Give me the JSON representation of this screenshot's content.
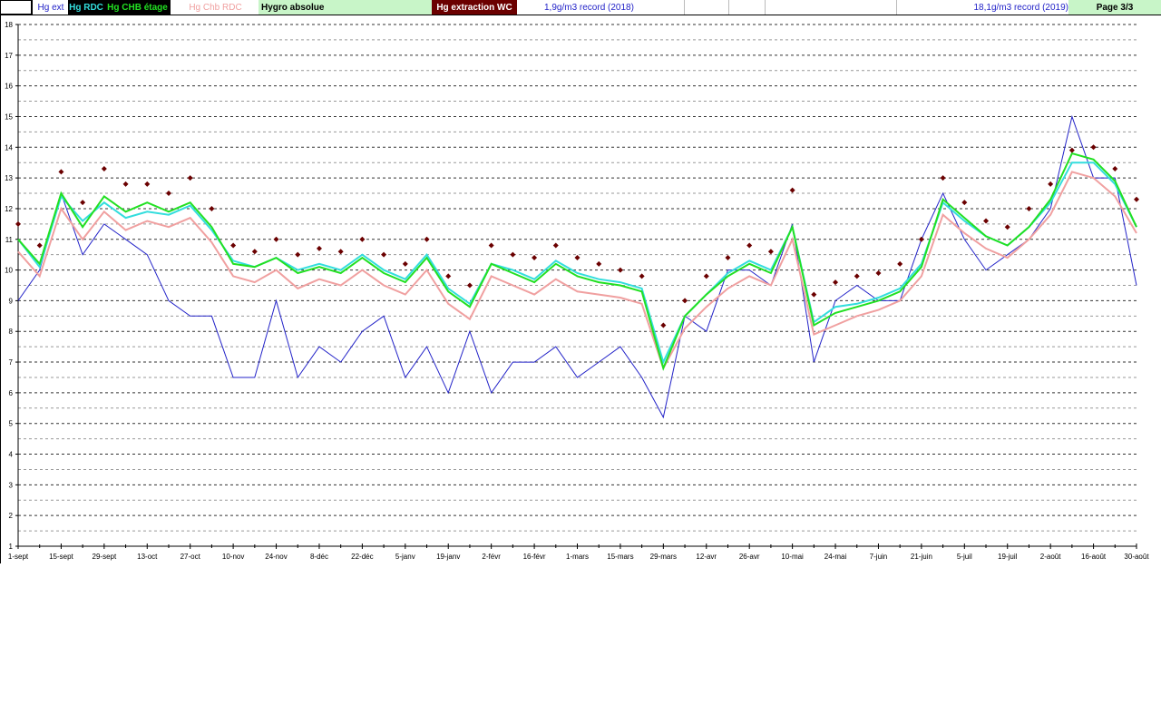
{
  "header": {
    "cells": [
      "Hg ext",
      "Hg RDC",
      "Hg CHB étage",
      "Hg Chb RDC",
      "Hygro absolue",
      "Hg extraction WC"
    ],
    "record_min": "1,9g/m3 record (2018)",
    "record_max": "18,1g/m3 record (2019)",
    "page": "Page 3/3"
  },
  "colors": {
    "ext": "#2323c8",
    "rdc": "#33dddd",
    "chb_etage": "#22e022",
    "chb_rdc": "#f0a0a0",
    "wc": "#6b0000",
    "header_green": "#c8f5c8"
  },
  "chart_data": {
    "type": "line",
    "title": "Hygro absolue",
    "ylim": [
      1,
      18
    ],
    "yticks": [
      1,
      2,
      3,
      4,
      5,
      6,
      7,
      8,
      9,
      10,
      11,
      12,
      13,
      14,
      15,
      16,
      17,
      18
    ],
    "grid": true,
    "xlim_days": [
      0,
      364
    ],
    "xtick_labels": [
      "1-sept",
      "15-sept",
      "29-sept",
      "13-oct",
      "27-oct",
      "10-nov",
      "24-nov",
      "8-déc",
      "22-déc",
      "5-janv",
      "19-janv",
      "2-févr",
      "16-févr",
      "1-mars",
      "15-mars",
      "29-mars",
      "12-avr",
      "26-avr",
      "10-mai",
      "24-mai",
      "7-juin",
      "21-juin",
      "5-juil",
      "19-juil",
      "2-août",
      "16-août",
      "30-août"
    ],
    "x_days": [
      0,
      7,
      14,
      21,
      28,
      35,
      42,
      49,
      56,
      63,
      70,
      77,
      84,
      91,
      98,
      105,
      112,
      119,
      126,
      133,
      140,
      147,
      154,
      161,
      168,
      175,
      182,
      189,
      196,
      203,
      210,
      217,
      224,
      231,
      238,
      245,
      252,
      259,
      266,
      273,
      280,
      287,
      294,
      301,
      308,
      315,
      322,
      329,
      336,
      343,
      350,
      357,
      364
    ],
    "series": [
      {
        "name": "Hg ext",
        "key": "ext",
        "style": "line",
        "values": [
          9.0,
          10.0,
          12.5,
          10.5,
          11.5,
          11.0,
          10.5,
          9.0,
          8.5,
          8.5,
          6.5,
          6.5,
          9.0,
          6.5,
          7.5,
          7.0,
          8.0,
          8.5,
          6.5,
          7.5,
          6.0,
          8.0,
          6.0,
          7.0,
          7.0,
          7.5,
          6.5,
          7.0,
          7.5,
          6.5,
          5.2,
          8.5,
          8.0,
          10.0,
          10.0,
          9.5,
          11.5,
          7.0,
          9.0,
          9.5,
          9.0,
          9.0,
          11.0,
          12.5,
          11.0,
          10.0,
          10.5,
          11.0,
          12.0,
          15.0,
          13.0,
          13.0,
          9.5
        ]
      },
      {
        "name": "Hg Chb RDC",
        "key": "chb_rdc",
        "style": "line",
        "values": [
          10.6,
          9.8,
          12.0,
          11.0,
          11.9,
          11.3,
          11.6,
          11.4,
          11.7,
          10.9,
          9.8,
          9.6,
          10.0,
          9.4,
          9.7,
          9.5,
          10.0,
          9.5,
          9.2,
          10.0,
          8.9,
          8.4,
          9.8,
          9.5,
          9.2,
          9.7,
          9.3,
          9.2,
          9.1,
          8.9,
          6.8,
          8.1,
          8.8,
          9.4,
          9.8,
          9.5,
          11.0,
          7.9,
          8.2,
          8.5,
          8.7,
          9.0,
          9.8,
          11.8,
          11.2,
          10.7,
          10.4,
          11.0,
          11.8,
          13.2,
          13.0,
          12.4,
          11.2
        ]
      },
      {
        "name": "Hg RDC",
        "key": "rdc",
        "style": "line",
        "values": [
          11.0,
          10.1,
          12.4,
          11.6,
          12.2,
          11.7,
          11.9,
          11.8,
          12.1,
          11.3,
          10.3,
          10.1,
          10.4,
          10.0,
          10.2,
          10.0,
          10.5,
          10.0,
          9.7,
          10.5,
          9.4,
          8.9,
          10.2,
          10.0,
          9.7,
          10.3,
          9.9,
          9.7,
          9.6,
          9.4,
          7.0,
          8.5,
          9.2,
          9.9,
          10.3,
          10.0,
          11.4,
          8.3,
          8.8,
          8.9,
          9.1,
          9.4,
          10.2,
          12.2,
          11.6,
          11.1,
          10.8,
          11.4,
          12.2,
          13.5,
          13.5,
          12.8,
          11.4
        ]
      },
      {
        "name": "Hg CHB étage",
        "key": "chb_etage",
        "style": "line",
        "values": [
          11.0,
          10.2,
          12.5,
          11.4,
          12.4,
          11.9,
          12.2,
          11.9,
          12.2,
          11.4,
          10.2,
          10.1,
          10.4,
          9.9,
          10.1,
          9.9,
          10.4,
          9.9,
          9.6,
          10.4,
          9.3,
          8.8,
          10.2,
          9.9,
          9.6,
          10.2,
          9.8,
          9.6,
          9.5,
          9.3,
          6.8,
          8.5,
          9.2,
          9.8,
          10.2,
          9.9,
          11.4,
          8.2,
          8.6,
          8.8,
          9.0,
          9.3,
          10.1,
          12.3,
          11.7,
          11.1,
          10.8,
          11.4,
          12.3,
          13.8,
          13.6,
          12.9,
          11.4
        ]
      },
      {
        "name": "Hg extraction WC",
        "key": "wc",
        "style": "marker",
        "values": [
          11.5,
          10.8,
          13.2,
          12.2,
          13.3,
          12.8,
          12.8,
          12.5,
          13.0,
          12.0,
          10.8,
          10.6,
          11.0,
          10.5,
          10.7,
          10.6,
          11.0,
          10.5,
          10.2,
          11.0,
          9.8,
          9.5,
          10.8,
          10.5,
          10.4,
          10.8,
          10.4,
          10.2,
          10.0,
          9.8,
          8.2,
          9.0,
          9.8,
          10.4,
          10.8,
          10.6,
          12.6,
          9.2,
          9.6,
          9.8,
          9.9,
          10.2,
          11.0,
          13.0,
          12.2,
          11.6,
          11.4,
          12.0,
          12.8,
          13.9,
          14.0,
          13.3,
          12.3
        ]
      }
    ]
  }
}
